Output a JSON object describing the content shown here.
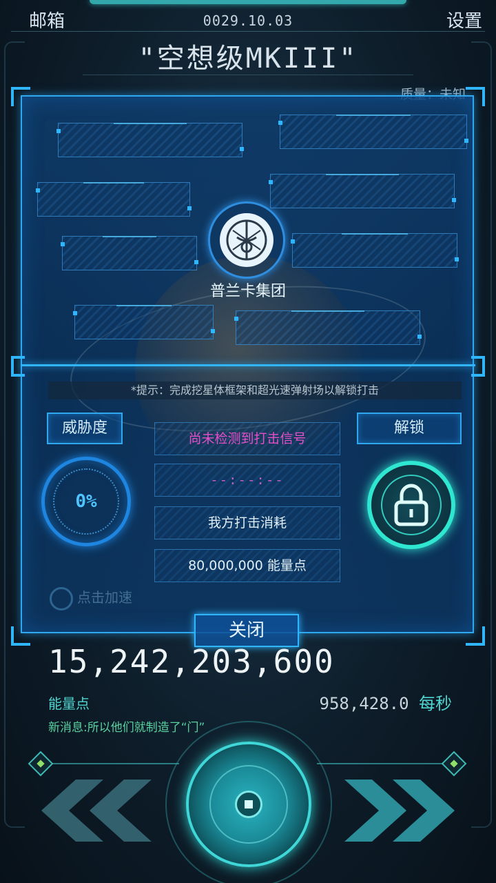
{
  "header": {
    "mail_label": "邮箱",
    "date": "0029.10.03",
    "settings_label": "设置",
    "ship_name": "\"空想级MKIII\"",
    "quality_text": "质量：未知"
  },
  "modal": {
    "faction_name": "普兰卡集团",
    "hint": "*提示：完成挖星体框架和超光速弹射场以解锁打击",
    "threat_label": "威胁度",
    "threat_value": "0%",
    "unlock_label": "解锁",
    "signal_status": "尚未检测到打击信号",
    "timer": "--:--:--",
    "cost_label": "我方打击消耗",
    "cost_value": "80,000,000 能量点",
    "accelerate_label": "点击加速",
    "close_label": "关闭"
  },
  "energy": {
    "total": "15,242,203,600",
    "label": "能量点",
    "rate_value": "958,428.0",
    "rate_unit": "每秒"
  },
  "news": {
    "text": "新消息:所以他们就制造了“门”"
  },
  "colors": {
    "accent_blue": "#2fb6ff",
    "accent_cyan": "#2fe6d0",
    "signal_magenta": "#e44fc8",
    "energy_green": "#4fd6d0"
  },
  "icons": {
    "faction": "faction-emblem-icon",
    "lock": "padlock-icon",
    "prev": "double-chevron-left-icon",
    "next": "double-chevron-right-icon"
  }
}
